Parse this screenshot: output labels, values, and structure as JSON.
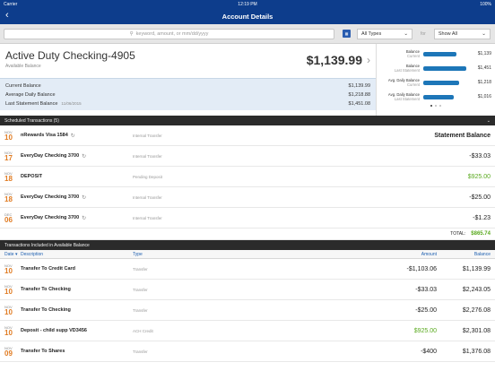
{
  "status": {
    "carrier": "Carrier",
    "time": "12:19 PM",
    "battery": "100%"
  },
  "nav": {
    "title": "Account Details",
    "back_icon": "chevron-left-icon"
  },
  "filters": {
    "search_placeholder": "keyword, amount, or mm/dd/yyyy",
    "type_select": "All Types",
    "for_label": "for",
    "show_select": "Show All"
  },
  "account": {
    "name": "Active Duty Checking-4905",
    "sub": "Available Balance",
    "balance": "$1,139.99",
    "current_label": "Current Balance",
    "current_value": "$1,139.99",
    "avg_label": "Average Daily Balance",
    "avg_value": "$1,218.88",
    "last_label": "Last Statement Balance",
    "last_date": "11/06/2015",
    "last_value": "$1,451.08"
  },
  "chart": {
    "bars": [
      {
        "label": "Balance",
        "sub": "Current",
        "value": "$1,139",
        "fraction": 0.78
      },
      {
        "label": "Balance",
        "sub": "Last Statement",
        "value": "$1,451",
        "fraction": 1.0
      },
      {
        "label": "Avg. Daily Balance",
        "sub": "Current",
        "value": "$1,218",
        "fraction": 0.84
      },
      {
        "label": "Avg. Daily Balance",
        "sub": "Last Statement",
        "value": "$1,016",
        "fraction": 0.7
      }
    ]
  },
  "scheduled": {
    "header": "Scheduled Transactions (5)",
    "rows": [
      {
        "mon": "NOV",
        "day": "10",
        "desc": "nRewards Visa 1584",
        "type": "Internal Transfer",
        "amount": "Statement Balance",
        "green": false,
        "bold": true
      },
      {
        "mon": "NOV",
        "day": "17",
        "desc": "EveryDay Checking 3700",
        "type": "Internal Transfer",
        "amount": "-$33.03",
        "green": false,
        "bold": false
      },
      {
        "mon": "NOV",
        "day": "18",
        "desc": "DEPOSIT",
        "type": "Pending Deposit",
        "amount": "$925.00",
        "green": true,
        "bold": false
      },
      {
        "mon": "NOV",
        "day": "18",
        "desc": "EveryDay Checking 3700",
        "type": "Internal Transfer",
        "amount": "-$25.00",
        "green": false,
        "bold": false
      },
      {
        "mon": "DEC",
        "day": "06",
        "desc": "EveryDay Checking 3700",
        "type": "Internal Transfer",
        "amount": "-$1.23",
        "green": false,
        "bold": false
      }
    ],
    "total_label": "TOTAL:",
    "total_value": "$865.74"
  },
  "included": {
    "header": "Transactions Included in Available Balance",
    "cols": {
      "date": "Date ▾",
      "desc": "Description",
      "type": "Type",
      "amount": "Amount",
      "balance": "Balance"
    },
    "rows": [
      {
        "mon": "NOV",
        "day": "10",
        "desc": "Transfer To Credit Card",
        "type": "Transfer",
        "amount": "-$1,103.06",
        "balance": "$1,139.99",
        "green": false
      },
      {
        "mon": "NOV",
        "day": "10",
        "desc": "Transfer To Checking",
        "type": "Transfer",
        "amount": "-$33.03",
        "balance": "$2,243.05",
        "green": false
      },
      {
        "mon": "NOV",
        "day": "10",
        "desc": "Transfer To Checking",
        "type": "Transfer",
        "amount": "-$25.00",
        "balance": "$2,276.08",
        "green": false
      },
      {
        "mon": "NOV",
        "day": "10",
        "desc": "Deposit - child supp VD3456",
        "type": "ACH Credit",
        "amount": "$925.00",
        "balance": "$2,301.08",
        "green": true
      },
      {
        "mon": "NOV",
        "day": "09",
        "desc": "Transfer To Shares",
        "type": "Transfer",
        "amount": "-$400",
        "balance": "$1,376.08",
        "green": false
      }
    ]
  }
}
